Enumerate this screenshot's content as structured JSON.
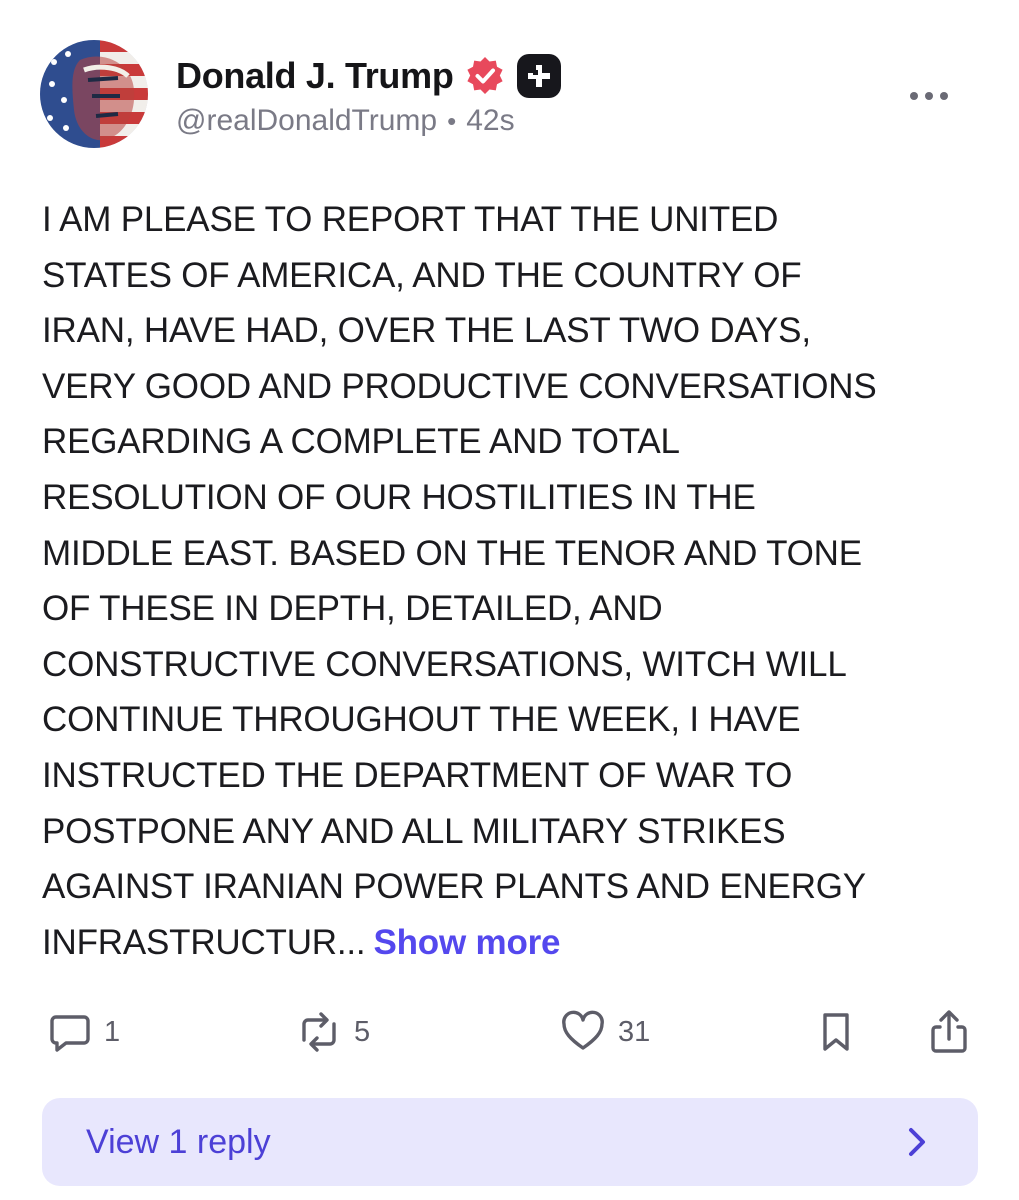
{
  "author": {
    "display_name": "Donald J. Trump",
    "handle": "@realDonaldTrump",
    "separator": "•",
    "time_ago": "42s",
    "verified_icon": "verified-check-icon",
    "badge_icon": "plus-badge-icon"
  },
  "post": {
    "lines": [
      "I AM PLEASE TO REPORT THAT THE UNITED",
      "STATES OF AMERICA, AND THE COUNTRY OF",
      "IRAN, HAVE HAD, OVER THE LAST TWO DAYS,",
      "VERY GOOD AND PRODUCTIVE CONVERSATIONS",
      "REGARDING A COMPLETE AND TOTAL",
      "RESOLUTION OF OUR HOSTILITIES IN THE",
      "MIDDLE EAST. BASED ON THE TENOR AND TONE",
      "OF THESE IN DEPTH, DETAILED, AND",
      "CONSTRUCTIVE CONVERSATIONS, WITCH WILL",
      "CONTINUE THROUGHOUT THE WEEK, I HAVE",
      "INSTRUCTED THE DEPARTMENT OF WAR TO",
      "POSTPONE ANY AND ALL MILITARY STRIKES",
      "AGAINST IRANIAN POWER PLANTS AND ENERGY",
      "INFRASTRUCTUR..."
    ],
    "show_more_label": "Show more"
  },
  "actions": {
    "reply_count": "1",
    "repost_count": "5",
    "like_count": "31"
  },
  "replies": {
    "label": "View 1 reply"
  },
  "colors": {
    "accent": "#5448ee",
    "reply_bar_bg": "#e8e7fd",
    "verified": "#e8495c",
    "muted": "#7a7a86"
  }
}
